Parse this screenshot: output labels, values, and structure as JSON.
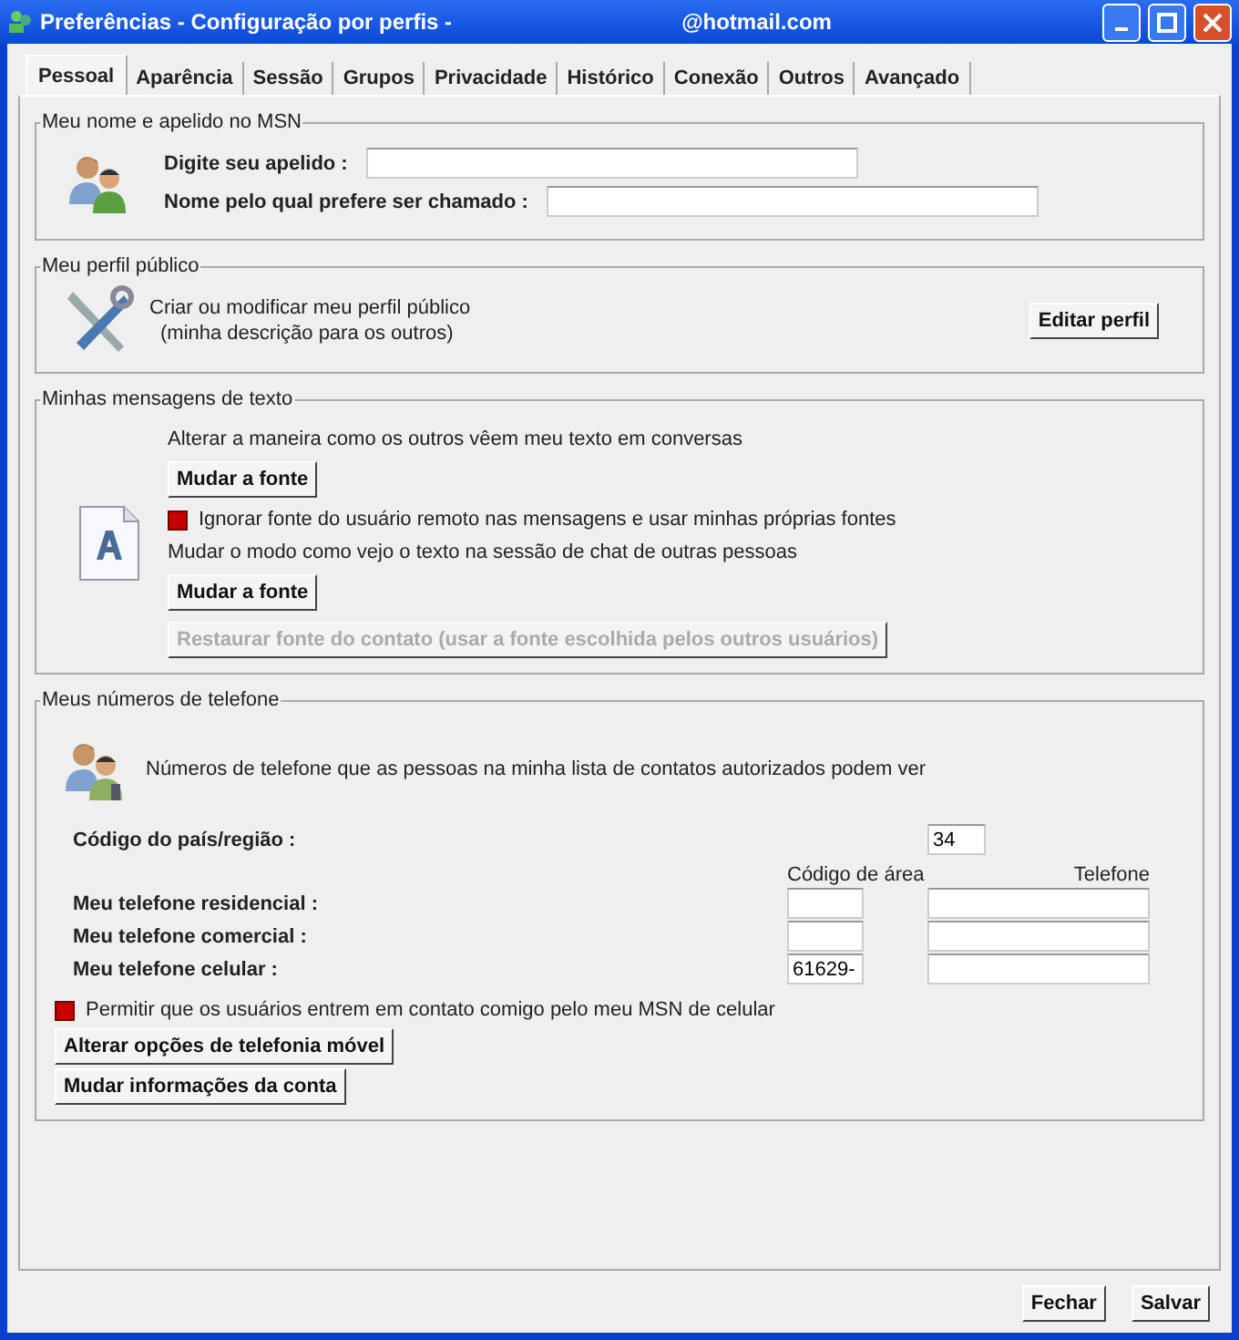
{
  "window": {
    "title": "Preferências - Configuração por perfis -",
    "title_account": "@hotmail.com"
  },
  "tabs": [
    {
      "label": "Pessoal",
      "selected": true
    },
    {
      "label": "Aparência",
      "selected": false
    },
    {
      "label": "Sessão",
      "selected": false
    },
    {
      "label": "Grupos",
      "selected": false
    },
    {
      "label": "Privacidade",
      "selected": false
    },
    {
      "label": "Histórico",
      "selected": false
    },
    {
      "label": "Conexão",
      "selected": false
    },
    {
      "label": "Outros",
      "selected": false
    },
    {
      "label": "Avançado",
      "selected": false
    }
  ],
  "name_group": {
    "title": "Meu nome e apelido no MSN",
    "fields": [
      {
        "label": "Digite seu apelido :"
      },
      {
        "label": "Nome pelo qual prefere ser chamado :"
      }
    ]
  },
  "profile_group": {
    "title": "Meu perfil público",
    "lines": [
      "Criar ou modificar meu perfil público",
      "(minha descrição para os outros)"
    ],
    "button": "Editar perfil"
  },
  "text_group": {
    "title": "Minhas mensagens de texto",
    "items": [
      {
        "kind": "text",
        "text": "Alterar a maneira como os outros vêem meu texto em conversas"
      },
      {
        "kind": "button",
        "label": "Mudar a fonte",
        "disabled": false
      },
      {
        "kind": "checkbox",
        "label": "Ignorar fonte do usuário remoto nas mensagens e usar minhas próprias fontes",
        "checked": true
      },
      {
        "kind": "text",
        "text": "Mudar o modo como vejo o texto na sessão de chat de outras pessoas"
      },
      {
        "kind": "button",
        "label": "Mudar a fonte",
        "disabled": false
      },
      {
        "kind": "button",
        "label": "Restaurar fonte do contato (usar a fonte escolhida pelos outros usuários)",
        "disabled": true
      }
    ]
  },
  "phone_group": {
    "title": "Meus números de telefone",
    "intro": "Números de telefone que as pessoas na minha lista de contatos autorizados podem ver",
    "country_label": "Código do país/região :",
    "country_value": "34",
    "area_header": "Código de área",
    "phone_header": "Telefone",
    "rows": [
      {
        "label": "Meu telefone residencial :"
      },
      {
        "label": "Meu telefone comercial :"
      },
      {
        "label": "Meu telefone celular :",
        "area": "61629-"
      }
    ],
    "checkbox": {
      "label": "Permitir que os usuários entrem em contato comigo pelo meu MSN de celular",
      "checked": true
    },
    "buttons": [
      "Alterar opções de telefonia móvel",
      "Mudar informações da conta"
    ]
  },
  "footer_buttons": [
    "Fechar",
    "Salvar"
  ]
}
